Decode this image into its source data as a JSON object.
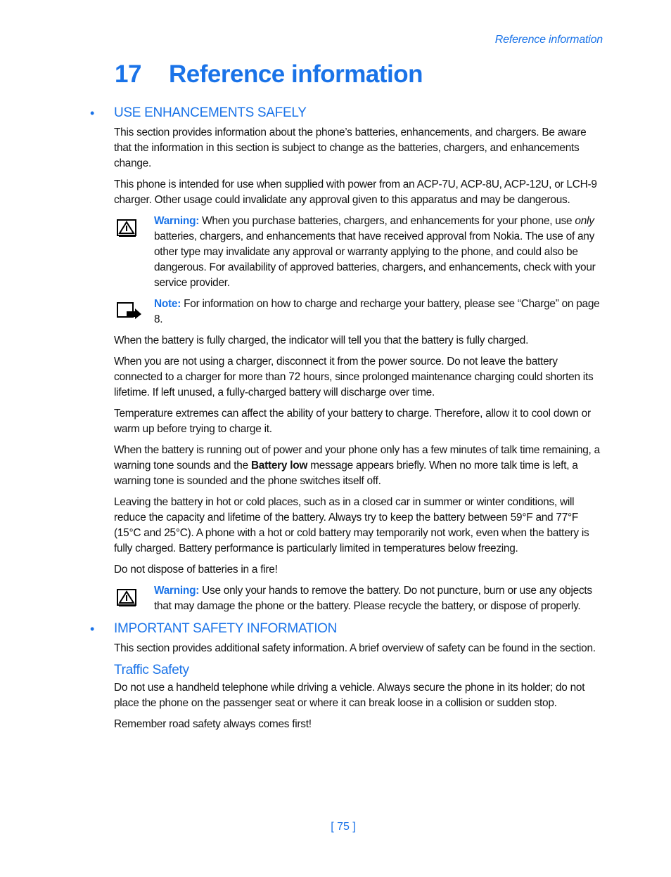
{
  "running_header": "Reference information",
  "chapter": {
    "number": "17",
    "title": "Reference information"
  },
  "sections": [
    {
      "heading": "USE ENHANCEMENTS SAFELY",
      "paragraphs": [
        "This section provides information about the phone’s batteries, enhancements, and chargers. Be aware that the information in this section is subject to change as the batteries, chargers, and enhancements change.",
        "This phone is intended for use when supplied with power from an ACP-7U, ACP-8U, ACP-12U, or LCH-9 charger. Other usage could invalidate any approval given to this apparatus and may be dangerous."
      ],
      "warning1": {
        "label": "Warning:",
        "text_before": " When you purchase batteries, chargers, and enhancements for your phone, use ",
        "emphasis": "only",
        "text_after": " batteries, chargers, and enhancements that have received approval from Nokia. The use of any other type may invalidate any approval or warranty applying to the phone, and could also be dangerous. For availability of approved batteries, chargers, and enhancements, check with your service provider."
      },
      "note": {
        "label": "Note:",
        "text": " For information on how to charge and recharge your battery, please see “Charge” on page 8."
      },
      "paragraphs2": [
        "When the battery is fully charged, the indicator will tell you that the battery is fully charged.",
        "When you are not using a charger, disconnect it from the power source. Do not leave the battery connected to a charger for more than 72 hours, since prolonged maintenance charging could shorten its lifetime. If left unused, a fully-charged battery will discharge over time.",
        "Temperature extremes can affect the ability of your battery to charge. Therefore, allow it to cool down or warm up before trying to charge it."
      ],
      "battery_low_para": {
        "before": "When the battery is running out of power and your phone only has a few minutes of talk time remaining, a warning tone sounds and the ",
        "bold": "Battery low",
        "after": " message appears briefly. When no more talk time is left, a warning tone is sounded and the phone switches itself off."
      },
      "paragraphs3": [
        "Leaving the battery in hot or cold places, such as in a closed car in summer or winter conditions, will reduce the capacity and lifetime of the battery. Always try to keep the battery between 59°F and 77°F (15°C and 25°C). A phone with a hot or cold battery may temporarily not work, even when the battery is fully charged. Battery performance is particularly limited in temperatures below freezing.",
        "Do not dispose of batteries in a fire!"
      ],
      "warning2": {
        "label": "Warning:",
        "text": " Use only your hands to remove the battery. Do not puncture, burn or use any objects that may damage the phone or the battery. Please recycle the battery, or dispose of properly."
      }
    },
    {
      "heading": "IMPORTANT SAFETY INFORMATION",
      "paragraphs": [
        "This section provides additional safety information. A brief overview of safety can be found in the section."
      ],
      "subsection": {
        "heading": "Traffic Safety",
        "paragraphs": [
          "Do not use a handheld telephone while driving a vehicle. Always secure the phone in its holder; do not place the phone on the passenger seat or where it can break loose in a collision or sudden stop.",
          "Remember road safety always comes first!"
        ]
      }
    }
  ],
  "bullet": "•",
  "page_number": "[ 75 ]",
  "icons": {
    "warning": "warning-triangle-icon",
    "note": "note-arrow-icon"
  },
  "colors": {
    "accent": "#1a73e8",
    "text": "#111111"
  }
}
